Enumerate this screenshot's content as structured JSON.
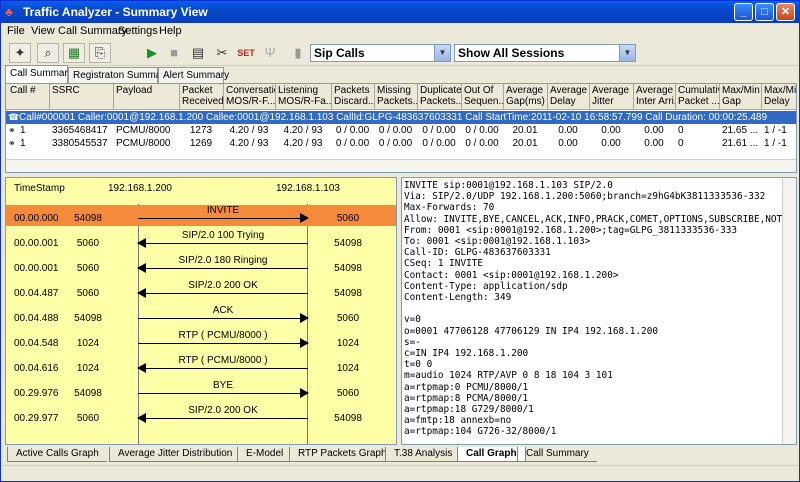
{
  "window": {
    "title": "Traffic Analyzer - Summary View",
    "min": "_",
    "max": "□",
    "close": "✕"
  },
  "menu": [
    "File",
    "View",
    "Call Summary",
    "Settings",
    "Help"
  ],
  "toolbar": {
    "filter_value": "Sip Calls",
    "session_value": "Show All Sessions"
  },
  "view_tabs": [
    "Call Summary",
    "Registraton Summary",
    "Alert Summary"
  ],
  "grid": {
    "columns": [
      "Call #",
      "SSRC",
      "Payload",
      "Packet\nReceived",
      "Conversatio\nMOS/R-F...",
      "Listening\nMOS/R-Fa...",
      "Packets\nDiscard...",
      "Missing\nPackets...",
      "Duplicate\nPackets...",
      "Out Of\nSequen...",
      "Average\nGap(ms)",
      "Average\nDelay",
      "Average\nJitter",
      "Average\nInter Arri...",
      "Cumulativ\nPacket ...",
      "Max/Min\nGap",
      "Max/Min\nDelay"
    ],
    "call_row": "Call#000001  Caller:0001@192.168.1.200  Callee:0001@192.168.1.103  CallId:GLPG-483637603331  Call StartTime:2011-02-10 16:58:57.799  Call Duration: 00:00:25.489",
    "rows": [
      [
        "1",
        "3365468417",
        "PCMU/8000",
        "1273",
        "4.20 / 93",
        "4.20 / 93",
        "0 / 0.00",
        "0 / 0.00",
        "0 / 0.00",
        "0 / 0.00",
        "20.01",
        "0.00",
        "0.00",
        "0.00",
        "0",
        "21.65 ...",
        "1 / -1"
      ],
      [
        "1",
        "3380545537",
        "PCMU/8000",
        "1269",
        "4.20 / 93",
        "4.20 / 93",
        "0 / 0.00",
        "0 / 0.00",
        "0 / 0.00",
        "0 / 0.00",
        "20.01",
        "0.00",
        "0.00",
        "0.00",
        "0",
        "21.61 ...",
        "1 / -1"
      ]
    ]
  },
  "call_graph": {
    "timestamp_label": "TimeStamp",
    "left_ip": "192.168.1.200",
    "right_ip": "192.168.1.103",
    "rows": [
      {
        "ts": "00.00.000",
        "lp": "54098",
        "msg": "INVITE",
        "rp": "5060",
        "dir": "right",
        "hl": true
      },
      {
        "ts": "00.00.001",
        "lp": "5060",
        "msg": "SIP/2.0 100 Trying",
        "rp": "54098",
        "dir": "left",
        "hl": false
      },
      {
        "ts": "00.00.001",
        "lp": "5060",
        "msg": "SIP/2.0 180 Ringing",
        "rp": "54098",
        "dir": "left",
        "hl": false
      },
      {
        "ts": "00.04.487",
        "lp": "5060",
        "msg": "SIP/2.0 200 OK",
        "rp": "54098",
        "dir": "left",
        "hl": false
      },
      {
        "ts": "00.04.488",
        "lp": "54098",
        "msg": "ACK",
        "rp": "5060",
        "dir": "right",
        "hl": false
      },
      {
        "ts": "00.04.548",
        "lp": "1024",
        "msg": "RTP ( PCMU/8000 )",
        "rp": "1024",
        "dir": "right",
        "hl": false
      },
      {
        "ts": "00.04.616",
        "lp": "1024",
        "msg": "RTP ( PCMU/8000 )",
        "rp": "1024",
        "dir": "left",
        "hl": false
      },
      {
        "ts": "00.29.976",
        "lp": "54098",
        "msg": "BYE",
        "rp": "5060",
        "dir": "right",
        "hl": false
      },
      {
        "ts": "00.29.977",
        "lp": "5060",
        "msg": "SIP/2.0 200 OK",
        "rp": "54098",
        "dir": "left",
        "hl": false
      }
    ]
  },
  "sip_message": "INVITE sip:0001@192.168.1.103 SIP/2.0\nVia: SIP/2.0/UDP 192.168.1.200:5060;branch=z9hG4bK3811333536-332\nMax-Forwards: 70\nAllow: INVITE,BYE,CANCEL,ACK,INFO,PRACK,COMET,OPTIONS,SUBSCRIBE,NOTI\nFrom: 0001 <sip:0001@192.168.1.200>;tag=GLPG_3811333536-333\nTo: 0001 <sip:0001@192.168.1.103>\nCall-ID: GLPG-483637603331\nCSeq: 1 INVITE\nContact: 0001 <sip:0001@192.168.1.200>\nContent-Type: application/sdp\nContent-Length: 349\n\nv=0\no=0001 47706128 47706129 IN IP4 192.168.1.200\ns=-\nc=IN IP4 192.168.1.200\nt=0 0\nm=audio 1024 RTP/AVP 0 8 18 104 3 101\na=rtpmap:0 PCMU/8000/1\na=rtpmap:8 PCMA/8000/1\na=rtpmap:18 G729/8000/1\na=fmtp:18 annexb=no\na=rtpmap:104 G726-32/8000/1",
  "bottom_tabs": [
    "Active Calls Graph",
    "Average Jitter Distribution",
    "E-Model",
    "RTP Packets Graph",
    "T.38 Analysis",
    "Call Graph",
    "Call Summary"
  ],
  "active_bottom_tab": "Call Graph"
}
